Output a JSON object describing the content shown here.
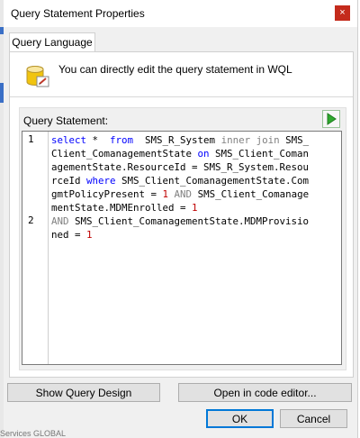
{
  "window": {
    "title": "Query Statement Properties",
    "close_glyph": "×"
  },
  "tabs": [
    {
      "label": "Query Language"
    }
  ],
  "header": {
    "text": "You can directly edit the query statement in WQL",
    "icon": "database-edit-icon"
  },
  "query": {
    "label": "Query Statement:",
    "run_icon": "run-icon",
    "line_numbers": [
      "1",
      "2"
    ]
  },
  "buttons": {
    "show_design": "Show Query Design",
    "open_editor": "Open in code editor...",
    "ok": "OK",
    "cancel": "Cancel"
  },
  "background_fragment": "Services GLOBAL "
}
